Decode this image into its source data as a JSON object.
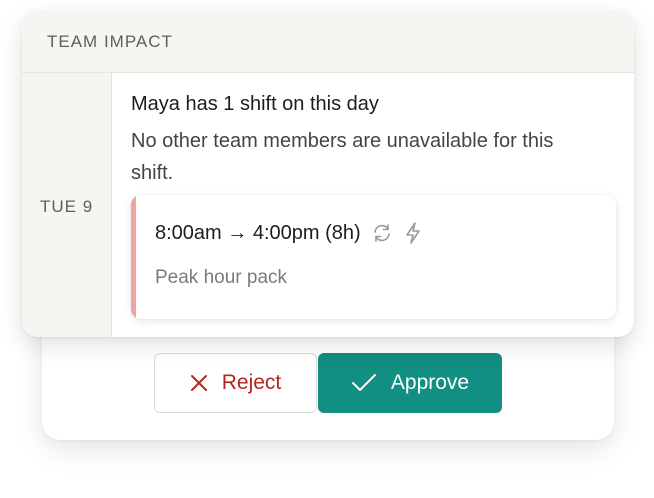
{
  "team_impact": {
    "title": "TEAM IMPACT",
    "day": "TUE 9",
    "summary": "Maya has 1 shift on this day",
    "detail": "No other team members are unavailable for this shift.",
    "shift": {
      "time": "8:00am → 4:00pm (8h)",
      "note": "Peak hour pack",
      "icons": [
        "repeat-icon",
        "lightning-icon"
      ]
    }
  },
  "actions": {
    "reject_label": "Reject",
    "approve_label": "Approve"
  },
  "colors": {
    "accent": "#118f82",
    "reject": "#b3261e",
    "shift_accent": "#f0a3a3"
  }
}
